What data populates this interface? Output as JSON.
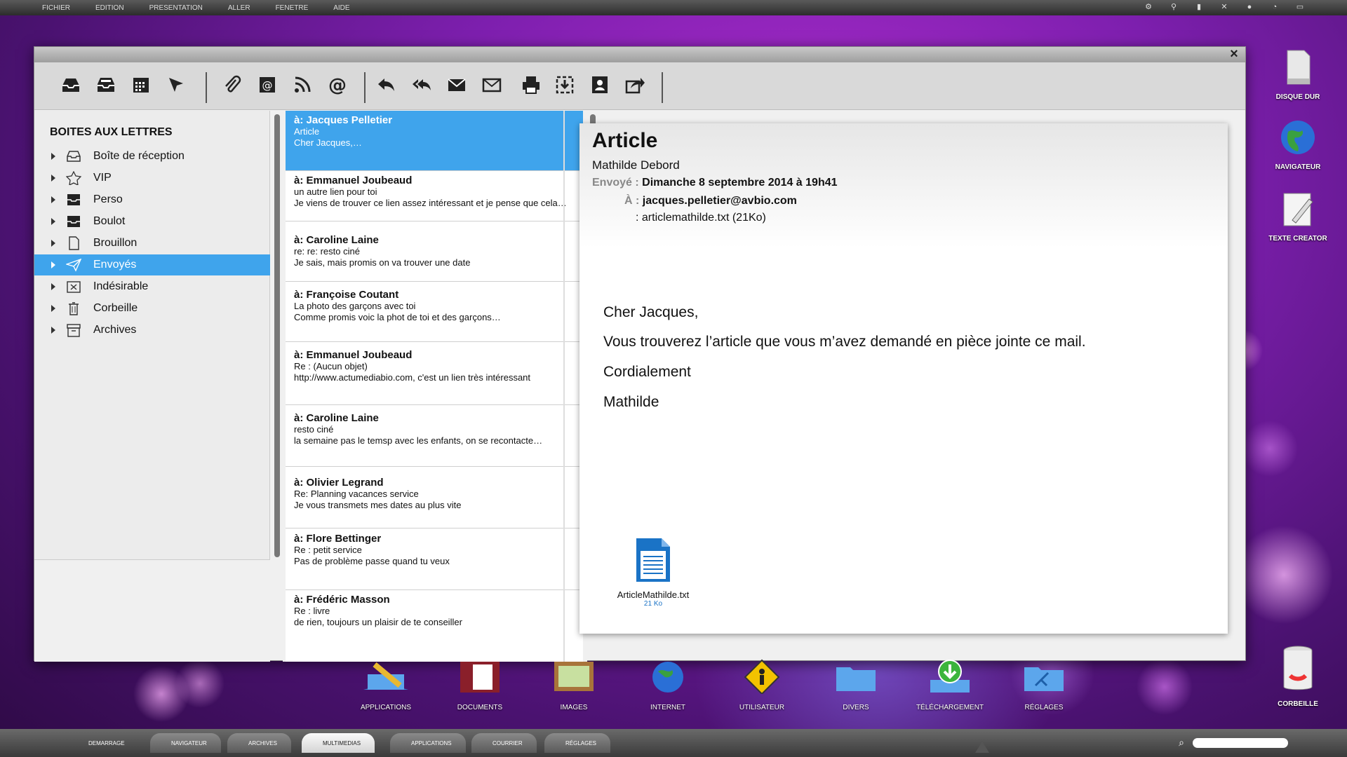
{
  "menubar": {
    "items": [
      "FICHIER",
      "EDITION",
      "PRESENTATION",
      "ALLER",
      "FENETRE",
      "AIDE"
    ]
  },
  "sidebar": {
    "header": "BOITES AUX LETTRES",
    "items": [
      {
        "label": "Boîte de réception",
        "icon": "inbox-icon"
      },
      {
        "label": "VIP",
        "icon": "star-icon"
      },
      {
        "label": "Perso",
        "icon": "tray-icon"
      },
      {
        "label": "Boulot",
        "icon": "tray-icon"
      },
      {
        "label": "Brouillon",
        "icon": "document-icon"
      },
      {
        "label": "Envoyés",
        "icon": "paper-plane-icon",
        "selected": true
      },
      {
        "label": "Indésirable",
        "icon": "junk-icon"
      },
      {
        "label": "Corbeille",
        "icon": "trash-icon"
      },
      {
        "label": "Archives",
        "icon": "archive-icon"
      }
    ]
  },
  "messages": [
    {
      "to": "à: Jacques Pelletier",
      "subject": "Article",
      "preview": "Cher Jacques,…",
      "selected": true
    },
    {
      "to": "à: Emmanuel Joubeaud",
      "subject": "un autre lien pour toi",
      "preview": "Je viens de trouver ce lien assez intéressant et je pense que cela…"
    },
    {
      "to": "à: Caroline Laine",
      "subject": "re: re: resto ciné",
      "preview": "Je sais, mais promis on va trouver une date"
    },
    {
      "to": "à: Françoise Coutant",
      "subject": "La photo des garçons avec toi",
      "preview": "Comme promis voic la phot de toi et des garçons…"
    },
    {
      "to": "à: Emmanuel Joubeaud",
      "subject": "Re : (Aucun objet)",
      "preview": "http://www.actumediabio.com, c'est un lien très intéressant"
    },
    {
      "to": "à: Caroline Laine",
      "subject": "resto ciné",
      "preview": "la semaine pas le temsp avec les enfants, on se recontacte…"
    },
    {
      "to": "à: Olivier Legrand",
      "subject": "Re: Planning vacances service",
      "preview": "Je vous transmets mes dates au plus vite"
    },
    {
      "to": "à: Flore Bettinger",
      "subject": "Re : petit service",
      "preview": "Pas de problème passe quand tu veux"
    },
    {
      "to": "à: Frédéric Masson",
      "subject": "Re : livre",
      "preview": "de rien, toujours un plaisir de te conseiller"
    }
  ],
  "reader": {
    "title": "Article",
    "from": "Mathilde  Debord",
    "sent_label": "Envoyé :",
    "sent_value": "Dimanche 8 septembre 2014 à 19h41",
    "to_label": "À :",
    "to_value": "jacques.pelletier@avbio.com",
    "att_label": ":",
    "att_value": "articlemathilde.txt (21Ko)",
    "body": [
      "Cher Jacques,",
      "Vous trouverez l’article que vous m’avez demandé en pièce jointe ce mail.",
      "Cordialement",
      "Mathilde"
    ],
    "attachment": {
      "name": "ArticleMathilde.txt",
      "size": "21 Ko"
    }
  },
  "dock": [
    "APPLICATIONS",
    "DOCUMENTS",
    "IMAGES",
    "INTERNET",
    "UTILISATEUR",
    "DIVERS",
    "TÉLÉCHARGEMENT",
    "RÉGLAGES"
  ],
  "desktop": [
    "DISQUE DUR",
    "NAVIGATEUR",
    "TEXTE CREATOR",
    "CORBEILLE"
  ],
  "taskbar": [
    "DEMARRAGE",
    "NAVIGATEUR",
    "ARCHIVES",
    "MULTIMEDIAS",
    "APPLICATIONS",
    "COURRIER",
    "RÉGLAGES"
  ],
  "colors": {
    "accent": "#3fa4ec",
    "window": "#f0f0f0"
  }
}
